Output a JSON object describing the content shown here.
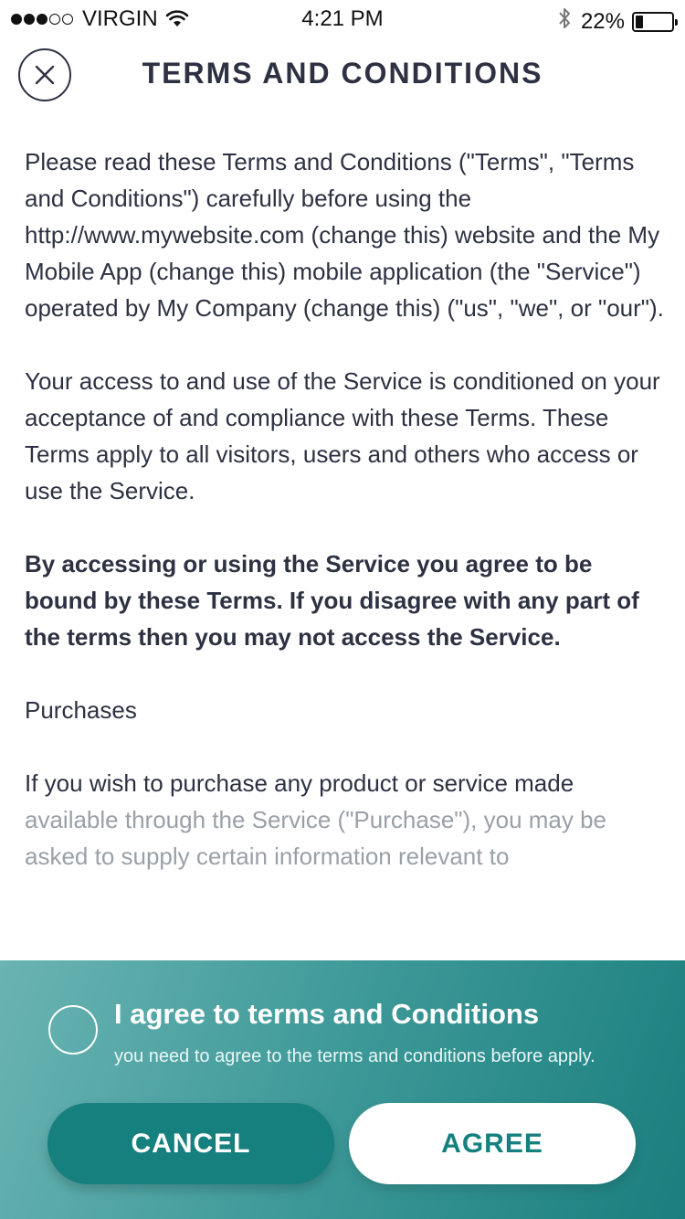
{
  "status_bar": {
    "carrier": "VIRGIN",
    "time": "4:21 PM",
    "battery": "22%",
    "battery_level": 0.22,
    "signal_strength": 3,
    "signal_max": 5
  },
  "header": {
    "title": "TERMS AND CONDITIONS",
    "close_icon": "close-icon"
  },
  "content": {
    "paragraph_1": "Please read these Terms and Conditions (\"Terms\", \"Terms and Conditions\") carefully before using the http://www.mywebsite.com (change this) website and the My Mobile App (change this) mobile application (the \"Service\") operated by My Company (change this) (\"us\", \"we\", or \"our\").",
    "paragraph_2": "Your access to and use of the Service is conditioned on your acceptance of and compliance with these Terms. These Terms apply to all visitors, users and others who access or use the Service.",
    "paragraph_3": "By accessing or using the Service you agree to be bound by these Terms. If you disagree with any part of the terms then you may not access the Service.",
    "heading_purchases": "Purchases",
    "paragraph_4_visible": "If you wish to purchase any product or service made",
    "paragraph_4_faded": "available through the Service (\"Purchase\"), you may be asked to supply certain information relevant to"
  },
  "agreement": {
    "title": "I agree to terms and Conditions",
    "subtitle": "you need to agree to the terms and conditions before apply.",
    "checked": false
  },
  "buttons": {
    "cancel": "CANCEL",
    "agree": "AGREE"
  },
  "colors": {
    "text": "#2d3142",
    "accent": "#16807f",
    "panel_start": "#6ab4b3",
    "panel_end": "#1a7f7e"
  }
}
